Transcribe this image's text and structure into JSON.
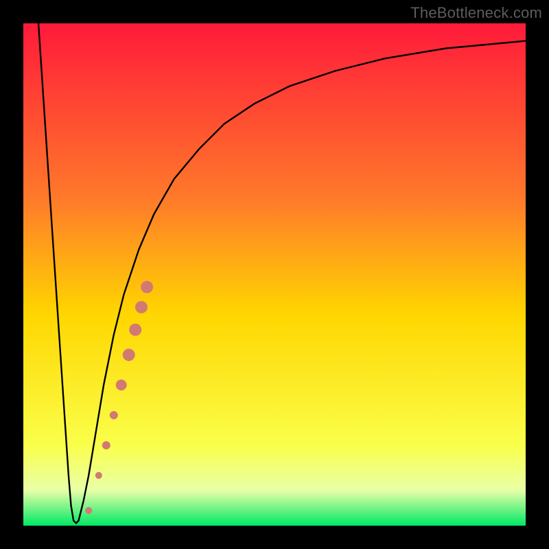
{
  "watermark": "TheBottleneck.com",
  "colors": {
    "frame": "#000000",
    "gradient_top": "#ff1a3a",
    "gradient_mid1": "#ff7a2a",
    "gradient_mid2": "#ffd600",
    "gradient_mid3": "#faff4a",
    "gradient_bottom": "#00e865",
    "curve": "#000000",
    "dots": "#d27a72"
  },
  "chart_data": {
    "type": "line",
    "title": "",
    "xlabel": "",
    "ylabel": "",
    "xlim": [
      0,
      100
    ],
    "ylim": [
      0,
      100
    ],
    "curve": {
      "name": "bottleneck-curve",
      "x": [
        3,
        5,
        7,
        9,
        9.5,
        10,
        10.5,
        11,
        12,
        13,
        14,
        16,
        18,
        20,
        23,
        26,
        30,
        35,
        40,
        46,
        53,
        62,
        72,
        84,
        100
      ],
      "y": [
        100,
        70,
        40,
        10,
        4,
        1,
        0.5,
        1,
        5,
        10,
        16,
        28,
        38,
        46,
        55,
        62,
        69,
        75,
        80,
        84,
        87.5,
        90.5,
        93,
        95,
        96.5
      ]
    },
    "dots": {
      "name": "highlighted-points",
      "points": [
        {
          "x": 13.0,
          "y": 3.0,
          "r": 5
        },
        {
          "x": 15.0,
          "y": 10.0,
          "r": 5
        },
        {
          "x": 16.5,
          "y": 16.0,
          "r": 6
        },
        {
          "x": 18.0,
          "y": 22.0,
          "r": 6
        },
        {
          "x": 19.5,
          "y": 28.0,
          "r": 8
        },
        {
          "x": 21.0,
          "y": 34.0,
          "r": 9
        },
        {
          "x": 22.3,
          "y": 39.0,
          "r": 9
        },
        {
          "x": 23.5,
          "y": 43.5,
          "r": 9
        },
        {
          "x": 24.6,
          "y": 47.5,
          "r": 9
        }
      ]
    }
  }
}
